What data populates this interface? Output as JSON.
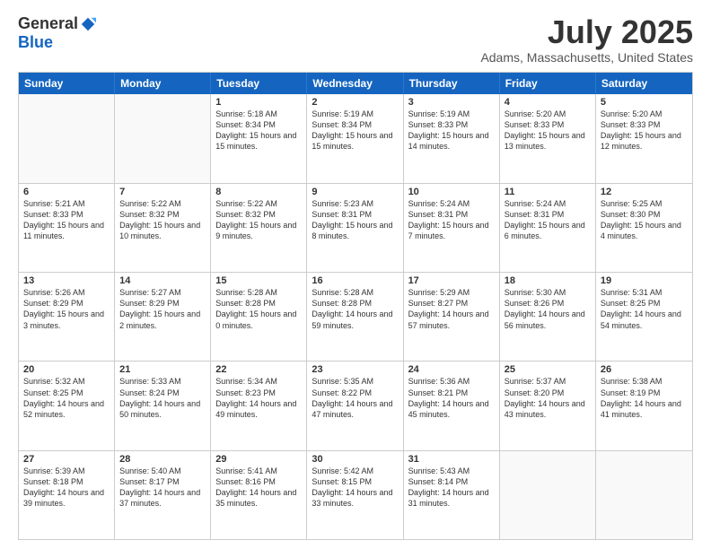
{
  "header": {
    "logo_general": "General",
    "logo_blue": "Blue",
    "title": "July 2025",
    "location": "Adams, Massachusetts, United States"
  },
  "weekdays": [
    "Sunday",
    "Monday",
    "Tuesday",
    "Wednesday",
    "Thursday",
    "Friday",
    "Saturday"
  ],
  "weeks": [
    [
      {
        "day": "",
        "empty": true
      },
      {
        "day": "",
        "empty": true
      },
      {
        "day": "1",
        "sunrise": "Sunrise: 5:18 AM",
        "sunset": "Sunset: 8:34 PM",
        "daylight": "Daylight: 15 hours and 15 minutes."
      },
      {
        "day": "2",
        "sunrise": "Sunrise: 5:19 AM",
        "sunset": "Sunset: 8:34 PM",
        "daylight": "Daylight: 15 hours and 15 minutes."
      },
      {
        "day": "3",
        "sunrise": "Sunrise: 5:19 AM",
        "sunset": "Sunset: 8:33 PM",
        "daylight": "Daylight: 15 hours and 14 minutes."
      },
      {
        "day": "4",
        "sunrise": "Sunrise: 5:20 AM",
        "sunset": "Sunset: 8:33 PM",
        "daylight": "Daylight: 15 hours and 13 minutes."
      },
      {
        "day": "5",
        "sunrise": "Sunrise: 5:20 AM",
        "sunset": "Sunset: 8:33 PM",
        "daylight": "Daylight: 15 hours and 12 minutes."
      }
    ],
    [
      {
        "day": "6",
        "sunrise": "Sunrise: 5:21 AM",
        "sunset": "Sunset: 8:33 PM",
        "daylight": "Daylight: 15 hours and 11 minutes."
      },
      {
        "day": "7",
        "sunrise": "Sunrise: 5:22 AM",
        "sunset": "Sunset: 8:32 PM",
        "daylight": "Daylight: 15 hours and 10 minutes."
      },
      {
        "day": "8",
        "sunrise": "Sunrise: 5:22 AM",
        "sunset": "Sunset: 8:32 PM",
        "daylight": "Daylight: 15 hours and 9 minutes."
      },
      {
        "day": "9",
        "sunrise": "Sunrise: 5:23 AM",
        "sunset": "Sunset: 8:31 PM",
        "daylight": "Daylight: 15 hours and 8 minutes."
      },
      {
        "day": "10",
        "sunrise": "Sunrise: 5:24 AM",
        "sunset": "Sunset: 8:31 PM",
        "daylight": "Daylight: 15 hours and 7 minutes."
      },
      {
        "day": "11",
        "sunrise": "Sunrise: 5:24 AM",
        "sunset": "Sunset: 8:31 PM",
        "daylight": "Daylight: 15 hours and 6 minutes."
      },
      {
        "day": "12",
        "sunrise": "Sunrise: 5:25 AM",
        "sunset": "Sunset: 8:30 PM",
        "daylight": "Daylight: 15 hours and 4 minutes."
      }
    ],
    [
      {
        "day": "13",
        "sunrise": "Sunrise: 5:26 AM",
        "sunset": "Sunset: 8:29 PM",
        "daylight": "Daylight: 15 hours and 3 minutes."
      },
      {
        "day": "14",
        "sunrise": "Sunrise: 5:27 AM",
        "sunset": "Sunset: 8:29 PM",
        "daylight": "Daylight: 15 hours and 2 minutes."
      },
      {
        "day": "15",
        "sunrise": "Sunrise: 5:28 AM",
        "sunset": "Sunset: 8:28 PM",
        "daylight": "Daylight: 15 hours and 0 minutes."
      },
      {
        "day": "16",
        "sunrise": "Sunrise: 5:28 AM",
        "sunset": "Sunset: 8:28 PM",
        "daylight": "Daylight: 14 hours and 59 minutes."
      },
      {
        "day": "17",
        "sunrise": "Sunrise: 5:29 AM",
        "sunset": "Sunset: 8:27 PM",
        "daylight": "Daylight: 14 hours and 57 minutes."
      },
      {
        "day": "18",
        "sunrise": "Sunrise: 5:30 AM",
        "sunset": "Sunset: 8:26 PM",
        "daylight": "Daylight: 14 hours and 56 minutes."
      },
      {
        "day": "19",
        "sunrise": "Sunrise: 5:31 AM",
        "sunset": "Sunset: 8:25 PM",
        "daylight": "Daylight: 14 hours and 54 minutes."
      }
    ],
    [
      {
        "day": "20",
        "sunrise": "Sunrise: 5:32 AM",
        "sunset": "Sunset: 8:25 PM",
        "daylight": "Daylight: 14 hours and 52 minutes."
      },
      {
        "day": "21",
        "sunrise": "Sunrise: 5:33 AM",
        "sunset": "Sunset: 8:24 PM",
        "daylight": "Daylight: 14 hours and 50 minutes."
      },
      {
        "day": "22",
        "sunrise": "Sunrise: 5:34 AM",
        "sunset": "Sunset: 8:23 PM",
        "daylight": "Daylight: 14 hours and 49 minutes."
      },
      {
        "day": "23",
        "sunrise": "Sunrise: 5:35 AM",
        "sunset": "Sunset: 8:22 PM",
        "daylight": "Daylight: 14 hours and 47 minutes."
      },
      {
        "day": "24",
        "sunrise": "Sunrise: 5:36 AM",
        "sunset": "Sunset: 8:21 PM",
        "daylight": "Daylight: 14 hours and 45 minutes."
      },
      {
        "day": "25",
        "sunrise": "Sunrise: 5:37 AM",
        "sunset": "Sunset: 8:20 PM",
        "daylight": "Daylight: 14 hours and 43 minutes."
      },
      {
        "day": "26",
        "sunrise": "Sunrise: 5:38 AM",
        "sunset": "Sunset: 8:19 PM",
        "daylight": "Daylight: 14 hours and 41 minutes."
      }
    ],
    [
      {
        "day": "27",
        "sunrise": "Sunrise: 5:39 AM",
        "sunset": "Sunset: 8:18 PM",
        "daylight": "Daylight: 14 hours and 39 minutes."
      },
      {
        "day": "28",
        "sunrise": "Sunrise: 5:40 AM",
        "sunset": "Sunset: 8:17 PM",
        "daylight": "Daylight: 14 hours and 37 minutes."
      },
      {
        "day": "29",
        "sunrise": "Sunrise: 5:41 AM",
        "sunset": "Sunset: 8:16 PM",
        "daylight": "Daylight: 14 hours and 35 minutes."
      },
      {
        "day": "30",
        "sunrise": "Sunrise: 5:42 AM",
        "sunset": "Sunset: 8:15 PM",
        "daylight": "Daylight: 14 hours and 33 minutes."
      },
      {
        "day": "31",
        "sunrise": "Sunrise: 5:43 AM",
        "sunset": "Sunset: 8:14 PM",
        "daylight": "Daylight: 14 hours and 31 minutes."
      },
      {
        "day": "",
        "empty": true
      },
      {
        "day": "",
        "empty": true
      }
    ]
  ]
}
